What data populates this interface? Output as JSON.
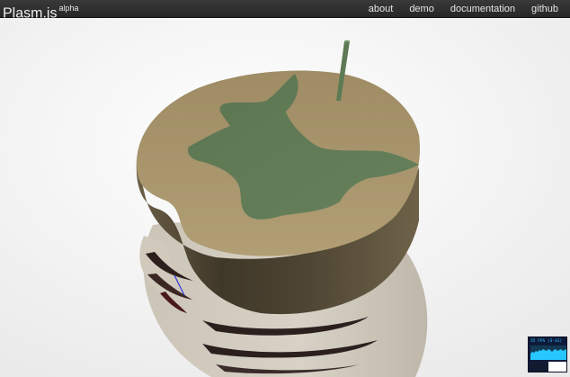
{
  "header": {
    "brand": "Plasm.js",
    "brand_tag": "alpha",
    "nav": [
      {
        "label": "about"
      },
      {
        "label": "demo"
      },
      {
        "label": "documentation"
      },
      {
        "label": "github"
      }
    ]
  },
  "stats_panel": {
    "fps_text": "35 FPS (3-41)",
    "fps_current": 35,
    "fps_min": 3,
    "fps_max": 41
  },
  "colors": {
    "top_face": "#a08e66",
    "pattern": "#5e7a56",
    "side": "#4a4232",
    "lower_layers": "#d3ccbf",
    "axis_pole": "#5d7a55",
    "stats_bg": "#0f1a3a",
    "stats_text": "#27c7ff"
  }
}
